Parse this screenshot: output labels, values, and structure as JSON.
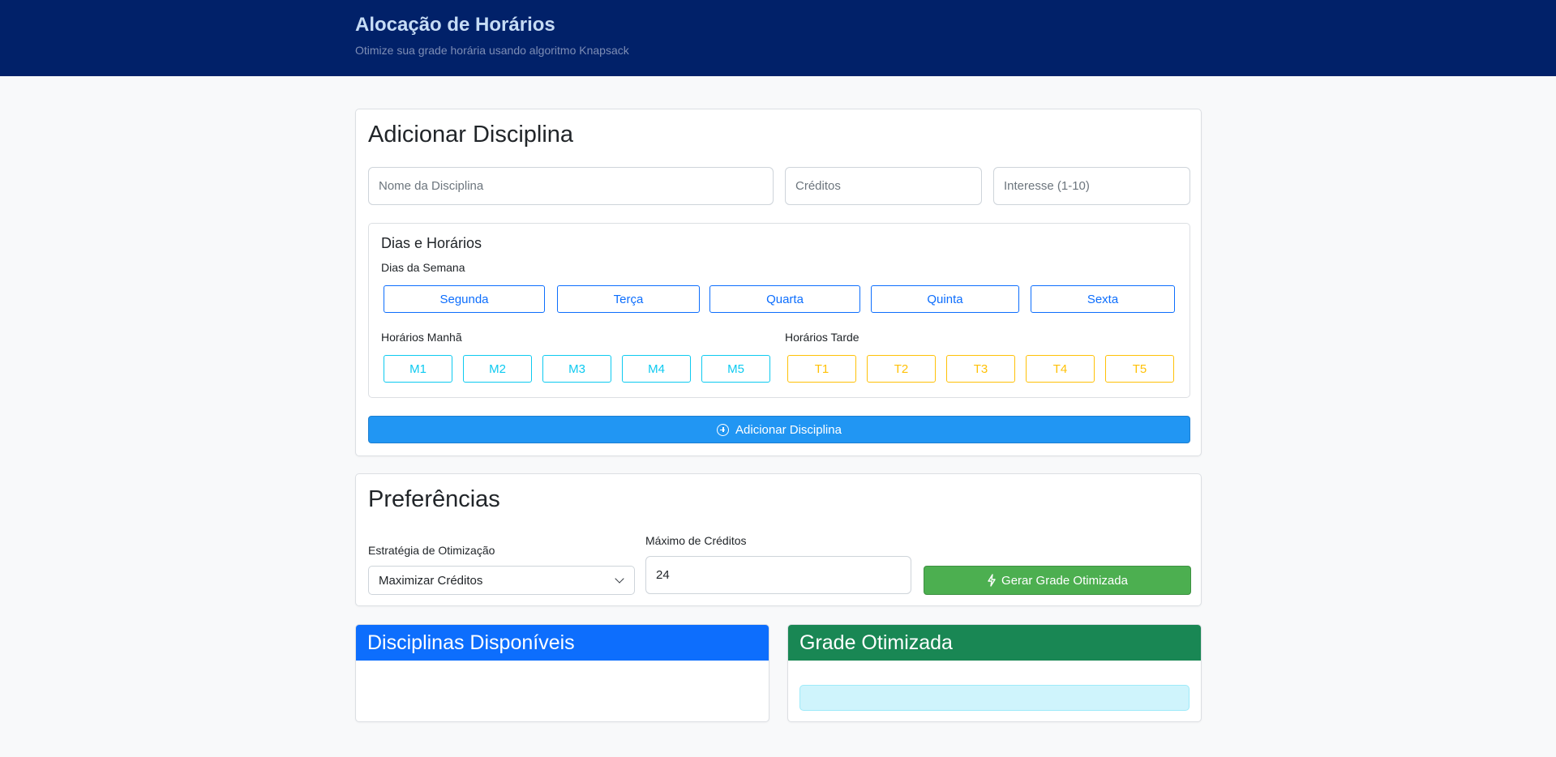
{
  "header": {
    "title": "Alocação de Horários",
    "subtitle": "Otimize sua grade horária usando algoritmo Knapsack"
  },
  "add_card": {
    "title": "Adicionar Disciplina",
    "name_placeholder": "Nome da Disciplina",
    "credits_placeholder": "Créditos",
    "interest_placeholder": "Interesse (1-10)",
    "schedule": {
      "title": "Dias e Horários",
      "days_label": "Dias da Semana",
      "days": [
        "Segunda",
        "Terça",
        "Quarta",
        "Quinta",
        "Sexta"
      ],
      "morning_label": "Horários Manhã",
      "morning": [
        "M1",
        "M2",
        "M3",
        "M4",
        "M5"
      ],
      "afternoon_label": "Horários Tarde",
      "afternoon": [
        "T1",
        "T2",
        "T3",
        "T4",
        "T5"
      ]
    },
    "add_button": "Adicionar Disciplina"
  },
  "prefs_card": {
    "title": "Preferências",
    "strategy_label": "Estratégia de Otimização",
    "strategy_value": "Maximizar Créditos",
    "max_credits_label": "Máximo de Créditos",
    "max_credits_value": "24",
    "generate_button": "Gerar Grade Otimizada"
  },
  "available_panel": {
    "title": "Disciplinas Disponíveis"
  },
  "optimized_panel": {
    "title": "Grade Otimizada"
  },
  "colors": {
    "header_bg": "#012169",
    "day_outline": "#0d6efd",
    "morning_outline": "#0dcaf0",
    "afternoon_outline": "#ffc107",
    "add_button": "#2196f3",
    "generate_button": "#4caf50",
    "available_header": "#0d6efd",
    "optimized_header": "#198754"
  }
}
